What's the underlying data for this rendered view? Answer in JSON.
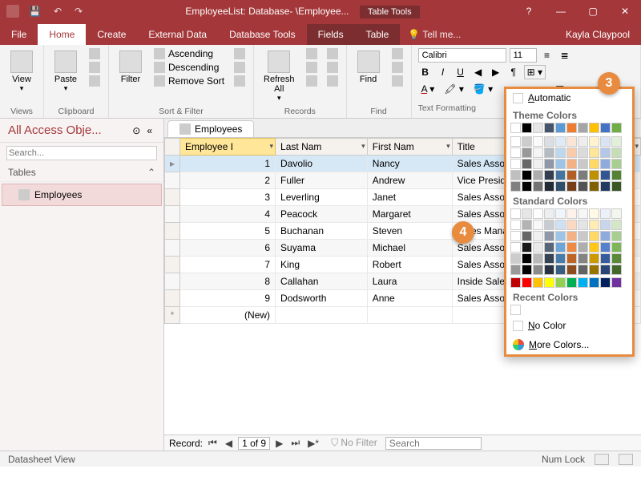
{
  "titlebar": {
    "title": "EmployeeList: Database- \\Employee...",
    "context_tab": "Table Tools",
    "user": "Kayla Claypool"
  },
  "tabs": {
    "file": "File",
    "home": "Home",
    "create": "Create",
    "external": "External Data",
    "dbtools": "Database Tools",
    "fields": "Fields",
    "table": "Table",
    "tellme": "Tell me..."
  },
  "ribbon": {
    "views": {
      "label": "Views",
      "view": "View"
    },
    "clipboard": {
      "label": "Clipboard",
      "paste": "Paste"
    },
    "sort": {
      "label": "Sort & Filter",
      "filter": "Filter",
      "asc": "Ascending",
      "desc": "Descending",
      "remove": "Remove Sort"
    },
    "records": {
      "label": "Records",
      "refresh": "Refresh\nAll"
    },
    "find": {
      "label": "Find",
      "find": "Find"
    },
    "textfmt": {
      "label": "Text Formatting",
      "font": "Calibri",
      "size": "11"
    }
  },
  "nav": {
    "title": "All Access Obje...",
    "group": "Tables",
    "items": [
      "Employees"
    ]
  },
  "datasheet": {
    "tab": "Employees",
    "columns": [
      "Employee ID",
      "Last Name",
      "First Name",
      "Title"
    ],
    "col_display": [
      "Employee I",
      "Last Nam",
      "First Nam",
      "Title"
    ],
    "rows": [
      {
        "id": "1",
        "last": "Davolio",
        "first": "Nancy",
        "title": "Sales Associate"
      },
      {
        "id": "2",
        "last": "Fuller",
        "first": "Andrew",
        "title": "Vice President, Sales"
      },
      {
        "id": "3",
        "last": "Leverling",
        "first": "Janet",
        "title": "Sales Associate"
      },
      {
        "id": "4",
        "last": "Peacock",
        "first": "Margaret",
        "title": "Sales Associate"
      },
      {
        "id": "5",
        "last": "Buchanan",
        "first": "Steven",
        "title": "Sales Manager"
      },
      {
        "id": "6",
        "last": "Suyama",
        "first": "Michael",
        "title": "Sales Associate"
      },
      {
        "id": "7",
        "last": "King",
        "first": "Robert",
        "title": "Sales Associate"
      },
      {
        "id": "8",
        "last": "Callahan",
        "first": "Laura",
        "title": "Inside Sales Coordinator"
      },
      {
        "id": "9",
        "last": "Dodsworth",
        "first": "Anne",
        "title": "Sales Associate"
      }
    ],
    "newrow": "(New)",
    "recnav": {
      "label": "Record:",
      "pos": "1 of 9",
      "nofilter": "No Filter",
      "search": "Search"
    }
  },
  "colorpicker": {
    "automatic": "Automatic",
    "theme_title": "Theme Colors",
    "theme_base": [
      "#ffffff",
      "#000000",
      "#e7e6e6",
      "#44546a",
      "#5b9bd5",
      "#ed7d31",
      "#a5a5a5",
      "#ffc000",
      "#4472c4",
      "#70ad47"
    ],
    "standard_title": "Standard Colors",
    "standard": [
      "#c00000",
      "#ff0000",
      "#ffc000",
      "#ffff00",
      "#92d050",
      "#00b050",
      "#00b0f0",
      "#0070c0",
      "#002060",
      "#7030a0"
    ],
    "recent_title": "Recent Colors",
    "nocolor": "No Color",
    "more": "More Colors..."
  },
  "status": {
    "view": "Datasheet View",
    "numlock": "Num Lock"
  },
  "callouts": {
    "c3": "3",
    "c4": "4"
  }
}
